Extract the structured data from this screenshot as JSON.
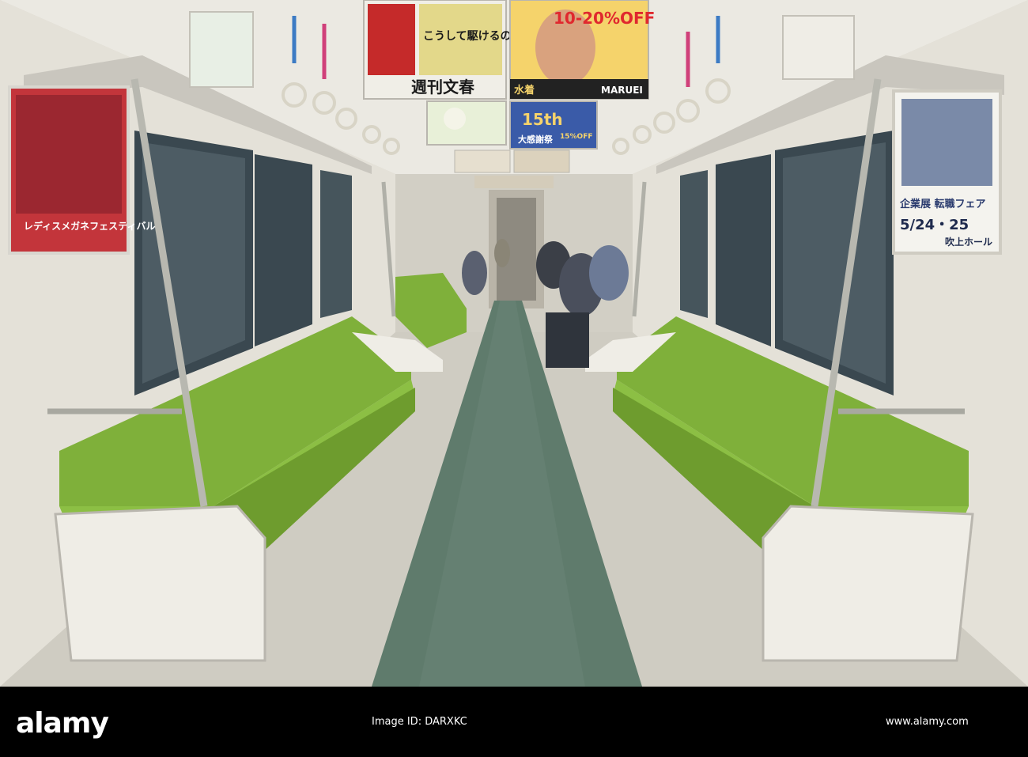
{
  "scene": {
    "description_colors": {
      "seat": "#7fb03a",
      "seat_dark": "#5f8f22",
      "floor": "#c9c6bd",
      "aisle_stripe": "#5c7a6a",
      "wall": "#e6e4dc",
      "window": "#3c4a52",
      "pole": "#b8b8b0"
    }
  },
  "ads": {
    "weekly_title": "週刊文春",
    "weekly_headline": "こうして駆けるの",
    "sale_label": "10-20%OFF",
    "sale_store": "MARUEI",
    "swimwear_label": "水着",
    "fifteenth_label": "15th",
    "fifteenth_sub": "大感謝祭",
    "fifteenth_off": "15%OFF",
    "job_fair": "企業展 転職フェア",
    "job_fair_date": "5/24・25",
    "job_fair_venue": "吹上ホール",
    "left_poster": "レディスメガネフェスティバル"
  },
  "footer": {
    "logo": "alamy",
    "image_id": "Image ID: DARXKC",
    "site_url": "www.alamy.com"
  }
}
